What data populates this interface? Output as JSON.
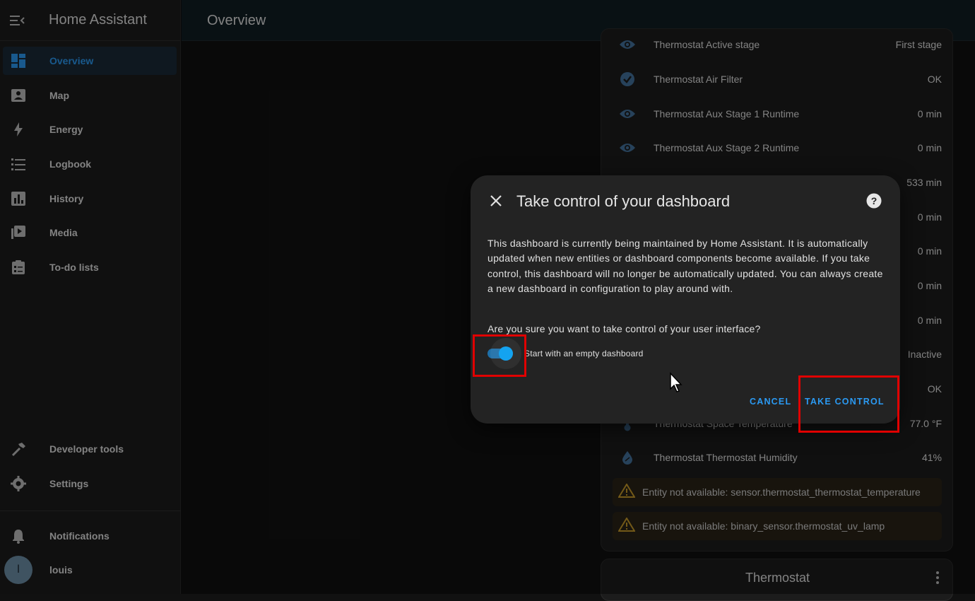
{
  "app": {
    "title": "Home Assistant"
  },
  "sidebar": {
    "items": [
      {
        "label": "Overview",
        "icon": "dashboard-icon"
      },
      {
        "label": "Map",
        "icon": "map-icon"
      },
      {
        "label": "Energy",
        "icon": "lightning-icon"
      },
      {
        "label": "Logbook",
        "icon": "logbook-icon"
      },
      {
        "label": "History",
        "icon": "chart-icon"
      },
      {
        "label": "Media",
        "icon": "media-icon"
      },
      {
        "label": "To-do lists",
        "icon": "clipboard-icon"
      }
    ],
    "bottom": [
      {
        "label": "Developer tools",
        "icon": "hammer-icon"
      },
      {
        "label": "Settings",
        "icon": "gear-icon"
      }
    ],
    "notifications_label": "Notifications",
    "user": {
      "initial": "l",
      "name": "louis"
    }
  },
  "topbar": {
    "title": "Overview"
  },
  "entities": [
    {
      "name": "Thermostat Active stage",
      "value": "First stage",
      "icon": "eye-icon"
    },
    {
      "name": "Thermostat Air Filter",
      "value": "OK",
      "icon": "check-circle-icon"
    },
    {
      "name": "Thermostat Aux Stage 1 Runtime",
      "value": "0 min",
      "icon": "eye-icon"
    },
    {
      "name": "Thermostat Aux Stage 2 Runtime",
      "value": "0 min",
      "icon": "eye-icon"
    },
    {
      "name": "",
      "value": "533 min",
      "icon": ""
    },
    {
      "name": "",
      "value": "0 min",
      "icon": ""
    },
    {
      "name": "",
      "value": "0 min",
      "icon": ""
    },
    {
      "name": "",
      "value": "0 min",
      "icon": ""
    },
    {
      "name": "",
      "value": "0 min",
      "icon": ""
    },
    {
      "name": "",
      "value": "Inactive",
      "icon": ""
    },
    {
      "name": "",
      "value": "OK",
      "icon": ""
    },
    {
      "name": "Thermostat Space Temperature",
      "value": "77.0 °F",
      "icon": "thermometer-icon"
    },
    {
      "name": "Thermostat Thermostat Humidity",
      "value": "41%",
      "icon": "humidity-icon"
    }
  ],
  "warnings": [
    "Entity not available: sensor.thermostat_thermostat_temperature",
    "Entity not available: binary_sensor.thermostat_uv_lamp"
  ],
  "second_card": {
    "title": "Thermostat"
  },
  "dialog": {
    "title": "Take control of your dashboard",
    "body": "This dashboard is currently being maintained by Home Assistant. It is automatically updated when new entities or dashboard components become available. If you take control, this dashboard will no longer be automatically updated. You can always create a new dashboard in configuration to play around with.",
    "question": "Are you sure you want to take control of your user interface?",
    "switch_label": "Start with an empty dashboard",
    "switch_on": true,
    "cancel_label": "CANCEL",
    "confirm_label": "TAKE CONTROL"
  },
  "colors": {
    "accent": "#2b9af3",
    "highlight": "#e00000",
    "warning": "#c79a2a"
  }
}
